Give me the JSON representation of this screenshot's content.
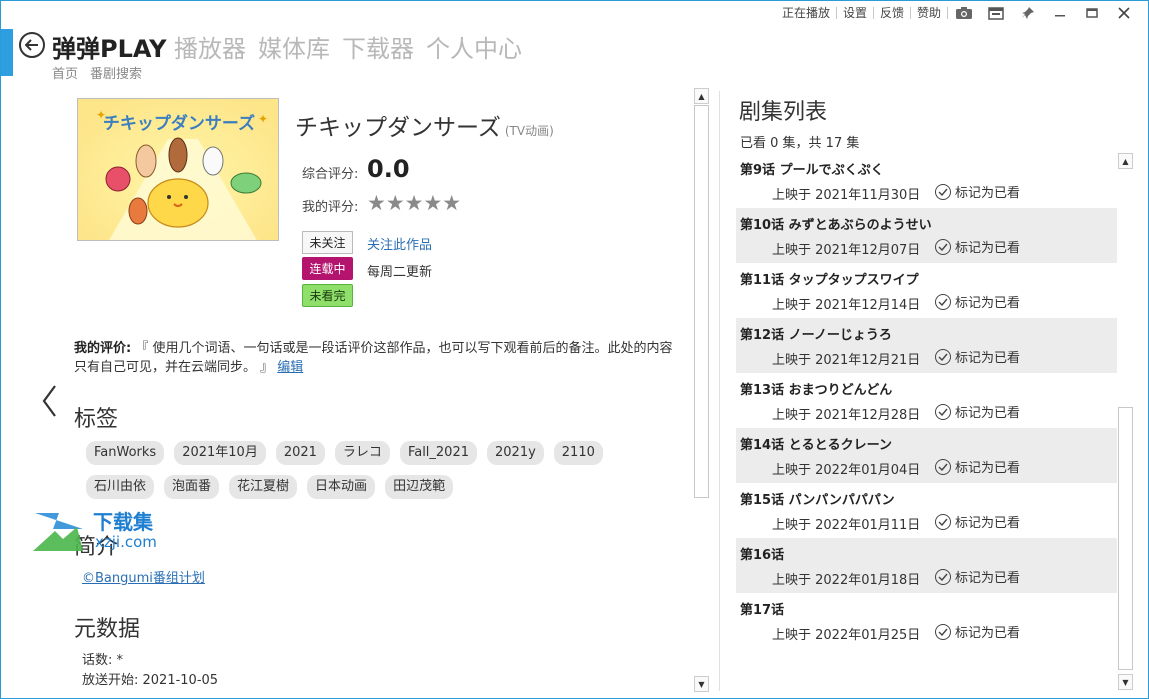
{
  "window": {
    "top_links": [
      "正在播放",
      "设置",
      "反馈",
      "赞助"
    ],
    "icons": [
      "camera-icon",
      "window-icon",
      "pin-icon",
      "minimize-icon",
      "maximize-icon",
      "close-icon"
    ]
  },
  "header": {
    "brand": "弹弹PLAY",
    "nav": [
      "播放器",
      "媒体库",
      "下载器",
      "个人中心"
    ],
    "breadcrumbs": [
      "首页",
      "番剧搜索"
    ]
  },
  "anime": {
    "title": "チキップダンサーズ",
    "type": "(TV动画)",
    "cover_text": "チキップダンサーズ",
    "overall_label": "综合评分:",
    "overall_score": "0.0",
    "my_label": "我的评分:",
    "my_stars": "★★★★★",
    "follow_status": "未关注",
    "follow_link": "关注此作品",
    "serial_badge": "连载中",
    "update_text": "每周二更新",
    "watch_badge": "未看完"
  },
  "review": {
    "label": "我的评价:",
    "text": "『 使用几个词语、一句话或是一段话评价这部作品，也可以写下观看前后的备注。此处的内容只有自己可见，并在云端同步。 』",
    "edit_link": "编辑"
  },
  "tags_section": {
    "heading": "标签",
    "tags": [
      "FanWorks",
      "2021年10月",
      "2021",
      "ラレコ",
      "Fall_2021",
      "2021y",
      "2110",
      "石川由依",
      "泡面番",
      "花江夏樹",
      "日本动画",
      "田辺茂範"
    ]
  },
  "watermark": {
    "text": "下载集",
    "sub": "xzji.com"
  },
  "intro": {
    "heading": "简介",
    "source_link": "©Bangumi番组计划"
  },
  "metadata": {
    "heading": "元数据",
    "lines": [
      "话数: *",
      "放送开始: 2021-10-05"
    ]
  },
  "episodes": {
    "heading": "剧集列表",
    "summary": "已看 0 集，共 17 集",
    "mark_label": "标记为已看",
    "items": [
      {
        "name": "第9话 プールでぷくぷく",
        "date": "上映于 2021年11月30日"
      },
      {
        "name": "第10话 みずとあぶらのようせい",
        "date": "上映于 2021年12月07日"
      },
      {
        "name": "第11话 タップタップスワイプ",
        "date": "上映于 2021年12月14日"
      },
      {
        "name": "第12话 ノーノーじょうろ",
        "date": "上映于 2021年12月21日"
      },
      {
        "name": "第13话 おまつりどんどん",
        "date": "上映于 2021年12月28日"
      },
      {
        "name": "第14话 とるとるクレーン",
        "date": "上映于 2022年01月04日"
      },
      {
        "name": "第15话 パンパンパパパン",
        "date": "上映于 2022年01月11日"
      },
      {
        "name": "第16话",
        "date": "上映于 2022年01月18日"
      },
      {
        "name": "第17话",
        "date": "上映于 2022年01月25日"
      }
    ]
  },
  "colors": {
    "accent": "#2d9ee0",
    "serial_badge": "#b4146e",
    "watch_badge": "#8fe06a",
    "link": "#2a6fb5"
  }
}
